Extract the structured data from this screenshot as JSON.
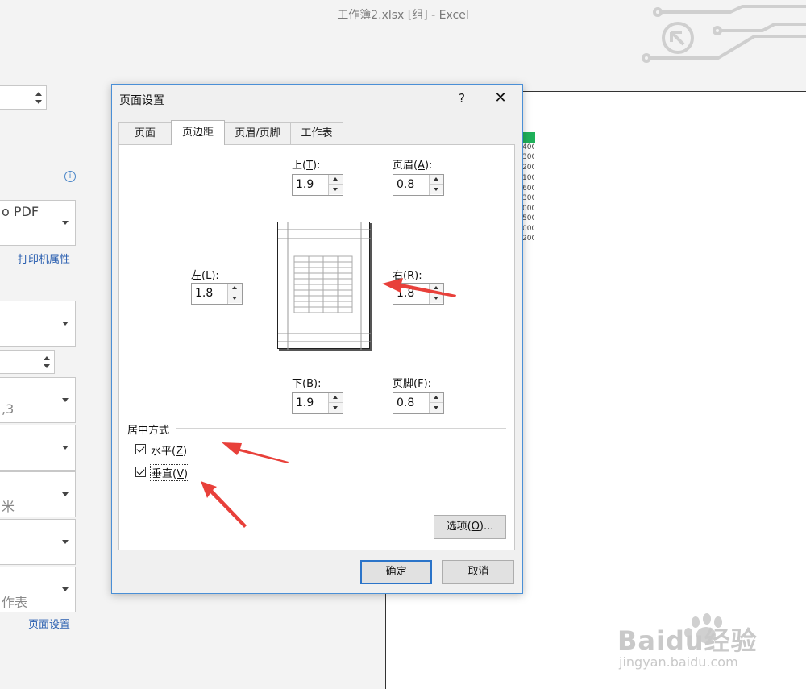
{
  "window": {
    "title": "工作簿2.xlsx  [组]  -  Excel"
  },
  "left_panel": {
    "printer_partial": "o PDF",
    "printer_properties_link": "打印机属性",
    "pages_partial": ",3",
    "margins_partial": "米",
    "sheets_partial": "作表",
    "page_setup_link": "页面设置"
  },
  "preview": {
    "numbers": [
      "400",
      "300",
      "200",
      "100",
      "600",
      "300",
      "000",
      "500",
      "000",
      "200"
    ]
  },
  "dialog": {
    "title": "页面设置",
    "help": "?",
    "close": "✕",
    "tabs": [
      "页面",
      "页边距",
      "页眉/页脚",
      "工作表"
    ],
    "active_tab": "页边距",
    "fields": {
      "top": {
        "label": "上(",
        "key": "T",
        "suffix": "):",
        "value": "1.9"
      },
      "header": {
        "label": "页眉(",
        "key": "A",
        "suffix": "):",
        "value": "0.8"
      },
      "left": {
        "label": "左(",
        "key": "L",
        "suffix": "):",
        "value": "1.8"
      },
      "right": {
        "label": "右(",
        "key": "R",
        "suffix": "):",
        "value": "1.8"
      },
      "bottom": {
        "label": "下(",
        "key": "B",
        "suffix": "):",
        "value": "1.9"
      },
      "footer": {
        "label": "页脚(",
        "key": "F",
        "suffix": "):",
        "value": "0.8"
      }
    },
    "center_group": {
      "label": "居中方式",
      "horizontal": {
        "label": "水平(",
        "key": "Z",
        "suffix": ")",
        "checked": true
      },
      "vertical": {
        "label": "垂直(",
        "key": "V",
        "suffix": ")",
        "checked": true
      }
    },
    "options_button": {
      "label": "选项(",
      "key": "O",
      "suffix": ")..."
    },
    "ok_button": "确定",
    "cancel_button": "取消"
  },
  "watermark": {
    "brand": "Baidu经验",
    "url": "jingyan.baidu.com"
  },
  "colors": {
    "accent": "#2b74c9",
    "arrow": "#e8403a",
    "cell_green": "#1fb15a"
  }
}
